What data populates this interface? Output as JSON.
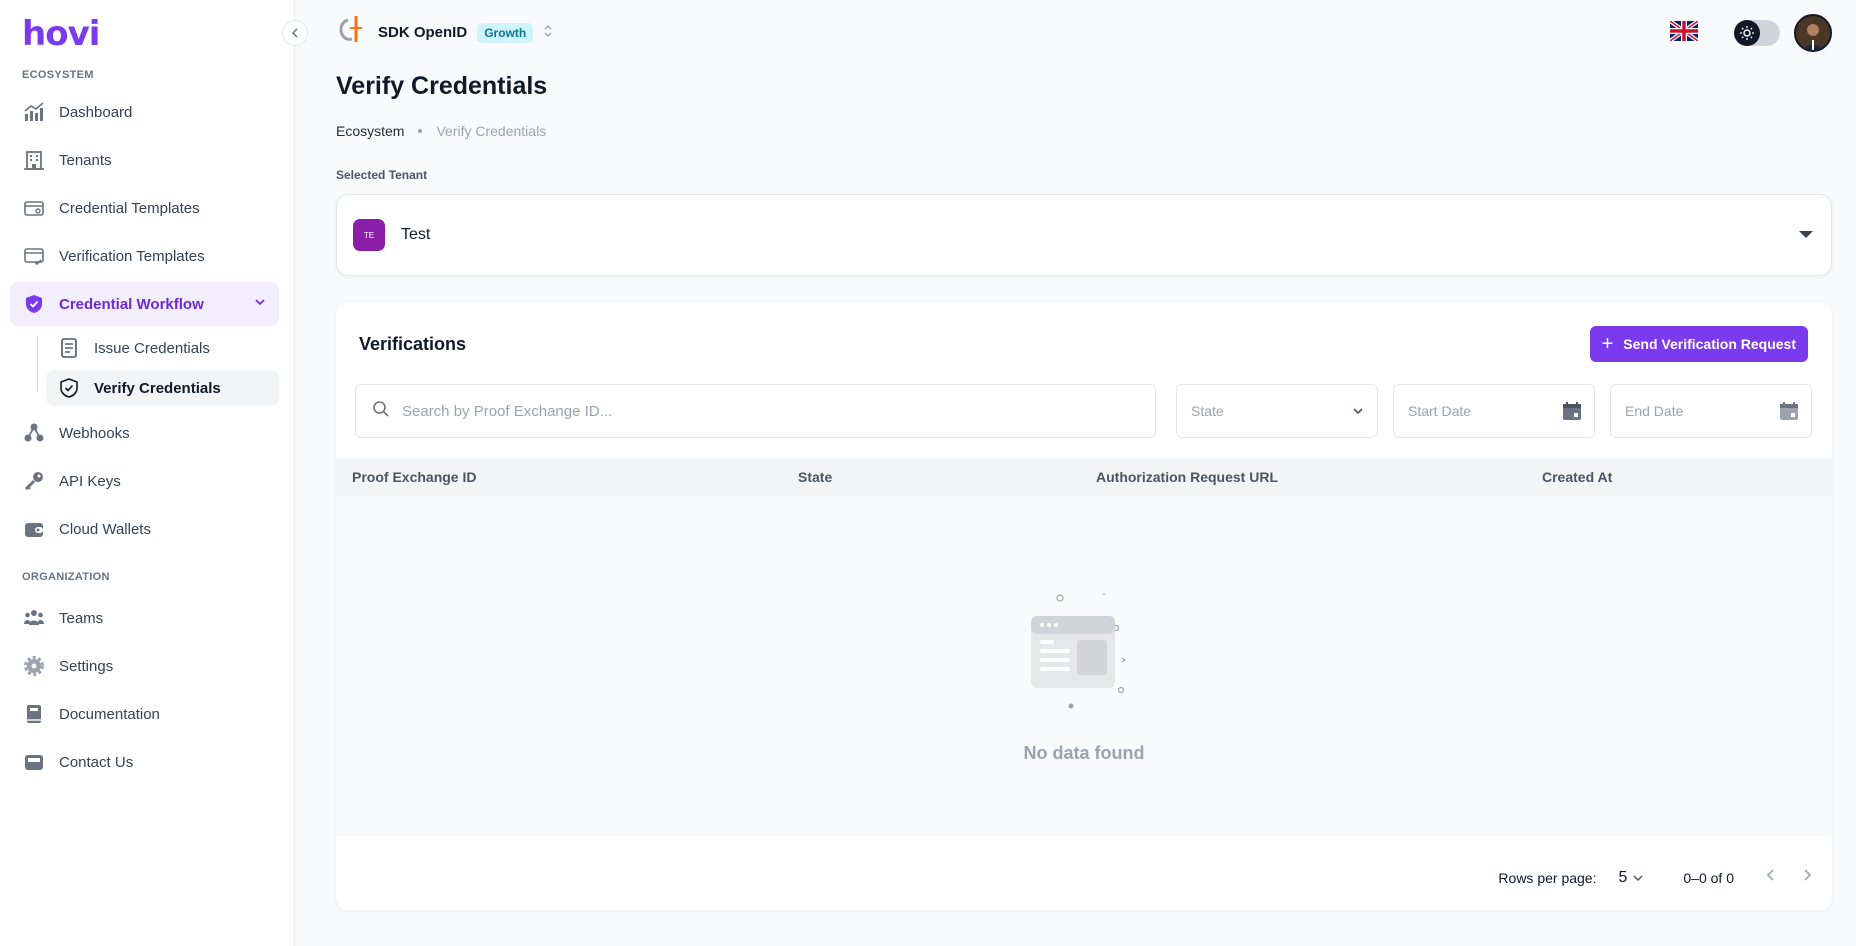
{
  "sidebar": {
    "logo": "hovi",
    "sections": {
      "ecosystem": "ECOSYSTEM",
      "organization": "ORGANIZATION"
    },
    "items": {
      "dashboard": "Dashboard",
      "tenants": "Tenants",
      "credential_templates": "Credential Templates",
      "verification_templates": "Verification Templates",
      "credential_workflow": "Credential Workflow",
      "issue_credentials": "Issue Credentials",
      "verify_credentials": "Verify Credentials",
      "webhooks": "Webhooks",
      "api_keys": "API Keys",
      "cloud_wallets": "Cloud Wallets",
      "teams": "Teams",
      "settings": "Settings",
      "documentation": "Documentation",
      "contact_us": "Contact Us"
    }
  },
  "topbar": {
    "org_name": "SDK OpenID",
    "plan_badge": "Growth"
  },
  "page": {
    "title": "Verify Credentials",
    "breadcrumb": [
      "Ecosystem",
      "Verify Credentials"
    ],
    "selected_tenant_label": "Selected Tenant",
    "tenant": {
      "initials": "TE",
      "name": "Test"
    }
  },
  "verifications": {
    "title": "Verifications",
    "send_button": "Send Verification Request",
    "search_placeholder": "Search by Proof Exchange ID...",
    "state_filter": "State",
    "start_date": "Start Date",
    "end_date": "End Date",
    "columns": [
      "Proof Exchange ID",
      "State",
      "Authorization Request URL",
      "Created At"
    ],
    "rows": [],
    "empty_text": "No data found"
  },
  "pagination": {
    "rows_per_page_label": "Rows per page:",
    "rows_per_page": "5",
    "range": "0–0 of 0"
  },
  "colors": {
    "accent": "#7c3aed",
    "tenant_avatar": "#8b1ea8",
    "badge_bg": "#cff4fc",
    "badge_text": "#0e7490"
  }
}
